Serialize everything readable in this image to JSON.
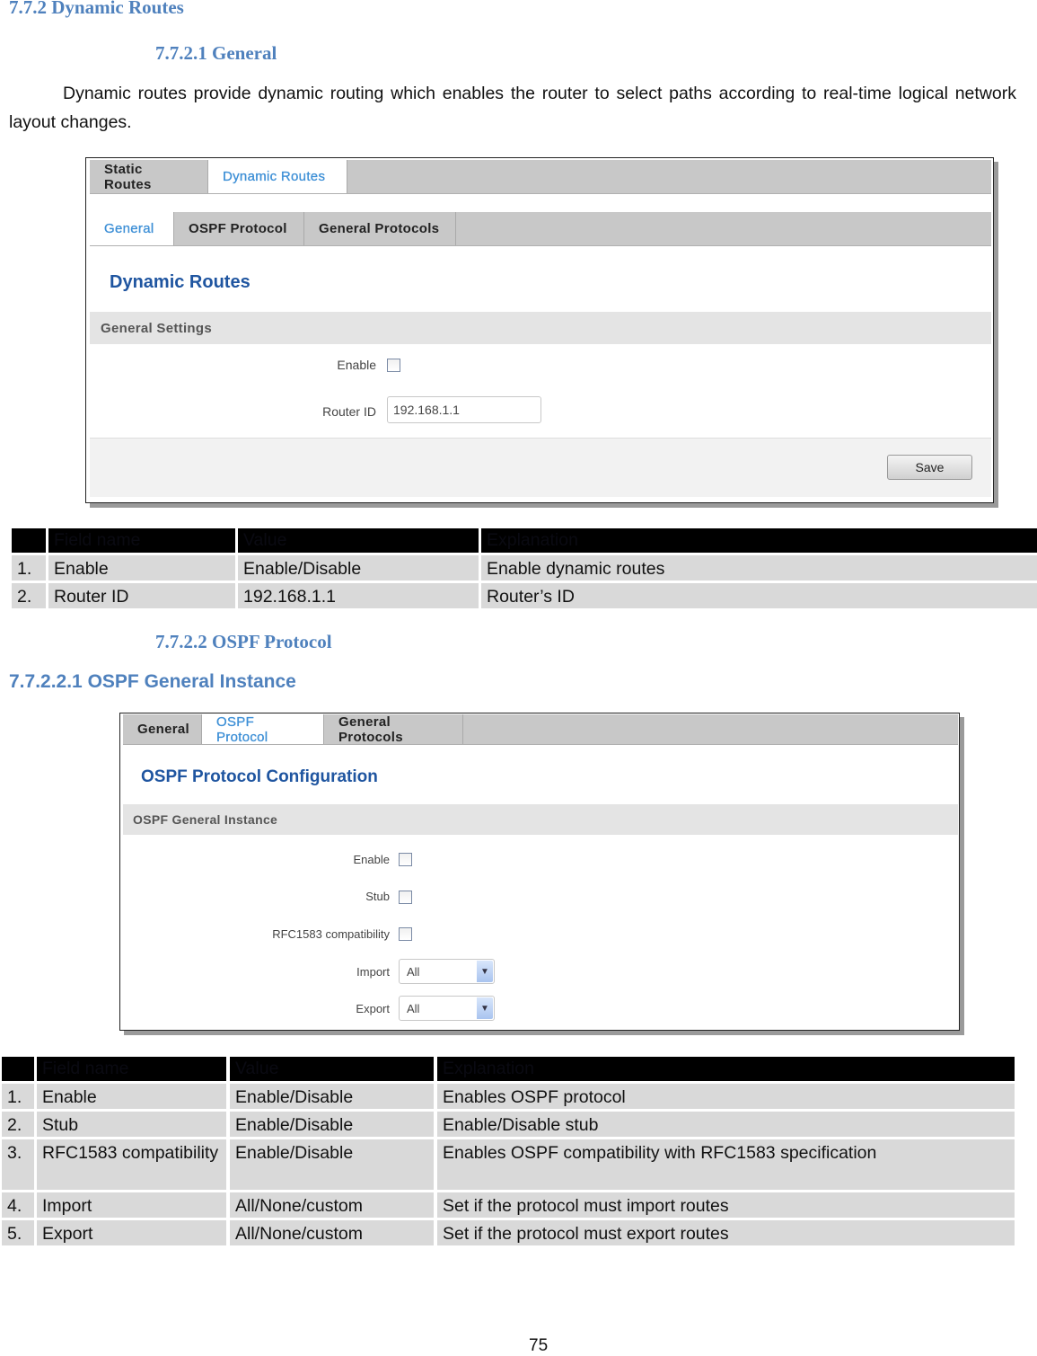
{
  "headings": {
    "h_772": "7.7.2  Dynamic Routes",
    "h_7721": "7.7.2.1    General",
    "h_7722": "7.7.2.2    OSPF Protocol",
    "h_77221": "7.7.2.2.1   OSPF General Instance"
  },
  "intro": {
    "paragraph": "Dynamic routes provide dynamic routing which enables the router to select paths according to real-time logical network layout changes."
  },
  "shot1": {
    "top_tabs": [
      {
        "label": "Static Routes",
        "active": false
      },
      {
        "label": "Dynamic Routes",
        "active": true
      }
    ],
    "sub_tabs": [
      {
        "label": "General",
        "active": true
      },
      {
        "label": "OSPF Protocol",
        "active": false
      },
      {
        "label": "General Protocols",
        "active": false
      }
    ],
    "title": "Dynamic Routes",
    "section": "General Settings",
    "enable_label": "Enable",
    "enable_checked": false,
    "router_id_label": "Router ID",
    "router_id_value": "192.168.1.1",
    "save_label": "Save"
  },
  "table1": {
    "headers": [
      "",
      "Field name",
      "Value",
      "Explanation"
    ],
    "rows": [
      [
        "1.",
        "Enable",
        "Enable/Disable",
        "Enable dynamic routes"
      ],
      [
        "2.",
        "Router ID",
        "192.168.1.1",
        "Router’s ID"
      ]
    ]
  },
  "shot2": {
    "tabs": [
      {
        "label": "General",
        "active": false
      },
      {
        "label": "OSPF Protocol",
        "active": true
      },
      {
        "label": "General Protocols",
        "active": false
      }
    ],
    "title": "OSPF Protocol Configuration",
    "section": "OSPF General Instance",
    "enable_label": "Enable",
    "stub_label": "Stub",
    "rfc_label": "RFC1583 compatibility",
    "import_label": "Import",
    "import_value": "All",
    "export_label": "Export",
    "export_value": "All"
  },
  "table2": {
    "headers": [
      "",
      "Field name",
      "Value",
      "Explanation"
    ],
    "rows": [
      [
        "1.",
        "Enable",
        "Enable/Disable",
        "Enables OSPF protocol"
      ],
      [
        "2.",
        "Stub",
        "Enable/Disable",
        "Enable/Disable stub"
      ],
      [
        "3.",
        "RFC1583 compatibility",
        "Enable/Disable",
        "Enables OSPF compatibility with RFC1583 specification"
      ],
      [
        "4.",
        "Import",
        "All/None/custom",
        "Set if the protocol must import routes"
      ],
      [
        "5.",
        "Export",
        "All/None/custom",
        "Set if the protocol must export routes"
      ]
    ]
  },
  "footer": {
    "page_number": "75"
  }
}
